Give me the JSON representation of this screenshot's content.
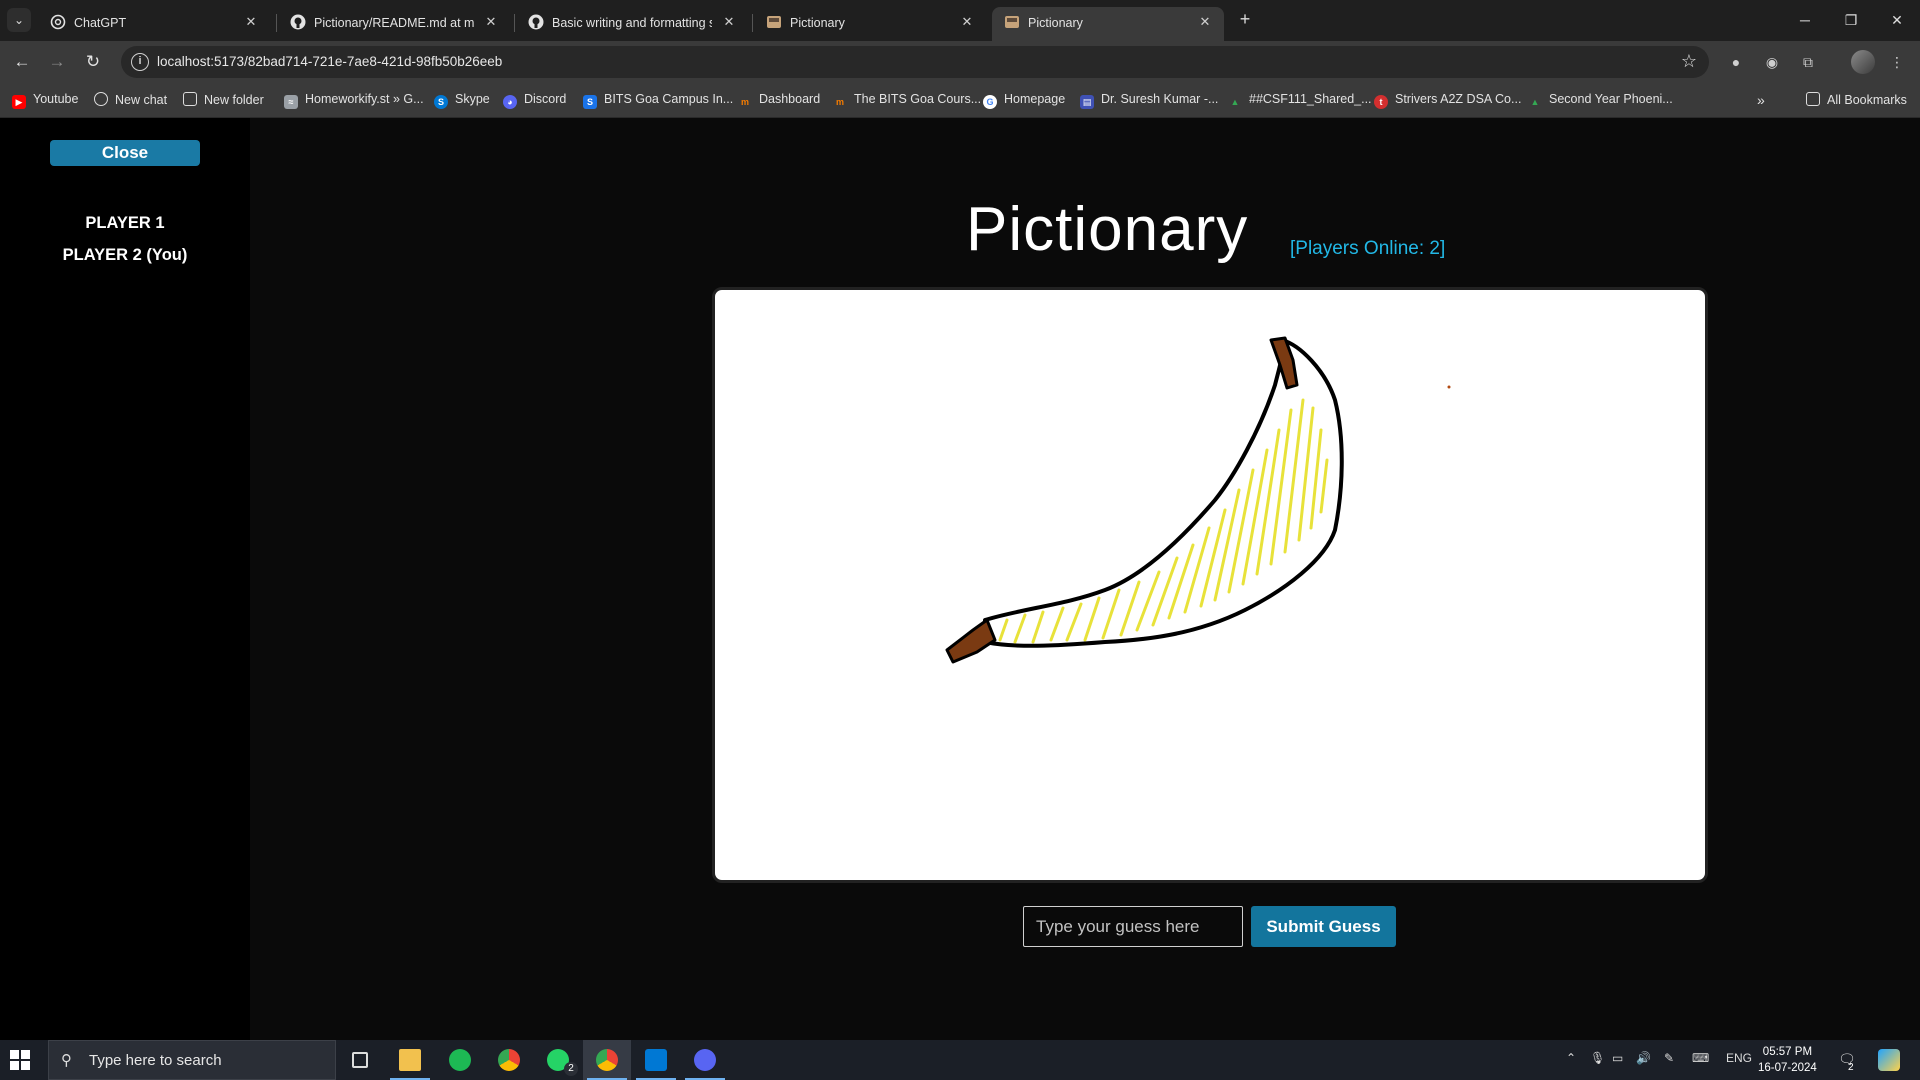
{
  "browser": {
    "tabs": [
      {
        "title": "ChatGPT",
        "active": false
      },
      {
        "title": "Pictionary/README.md at main",
        "active": false
      },
      {
        "title": "Basic writing and formatting sy",
        "active": false
      },
      {
        "title": "Pictionary",
        "active": false
      },
      {
        "title": "Pictionary",
        "active": true
      }
    ],
    "new_tab": "+",
    "url": "localhost:5173/82bad714-721e-7ae8-421d-98fb50b26eeb",
    "bookmarks": [
      {
        "label": "Youtube",
        "color": "#ff0000"
      },
      {
        "label": "New chat",
        "color": "#ffffff"
      },
      {
        "label": "New folder",
        "color": "#cfcfcf"
      },
      {
        "label": "Homeworkify.st » G...",
        "color": "#9aa0a6"
      },
      {
        "label": "Skype",
        "color": "#0078d4"
      },
      {
        "label": "Discord",
        "color": "#5865f2"
      },
      {
        "label": "BITS Goa Campus In...",
        "color": "#1a73e8"
      },
      {
        "label": "Dashboard",
        "color": "#f57c00"
      },
      {
        "label": "The BITS Goa Cours...",
        "color": "#f57c00"
      },
      {
        "label": "Homepage",
        "color": "#ffffff"
      },
      {
        "label": "Dr. Suresh Kumar -...",
        "color": "#3f51b5"
      },
      {
        "label": "##CSF111_Shared_...",
        "color": "#34a853"
      },
      {
        "label": "Strivers A2Z DSA Co...",
        "color": "#d32f2f"
      },
      {
        "label": "Second Year Phoeni...",
        "color": "#34a853"
      }
    ],
    "all_bookmarks": "All Bookmarks"
  },
  "sidebar": {
    "close_label": "Close",
    "players": [
      "PLAYER 1",
      "PLAYER 2 (You)"
    ]
  },
  "game": {
    "title": "Pictionary",
    "players_online": "[Players Online: 2]",
    "guess_placeholder": "Type your guess here",
    "guess_value": "",
    "submit_label": "Submit Guess",
    "drawing_colors": {
      "outline": "#000000",
      "fill": "#e8e23a",
      "stem": "#7a3a12"
    }
  },
  "taskbar": {
    "search_placeholder": "Type here to search",
    "apps": [
      "task-view",
      "file-explorer",
      "spotify",
      "chrome",
      "whatsapp",
      "chrome-active",
      "vscode",
      "discord"
    ],
    "whatsapp_badge": "2",
    "language": "ENG",
    "time": "05:57 PM",
    "date": "16-07-2024",
    "notifications": "2"
  }
}
